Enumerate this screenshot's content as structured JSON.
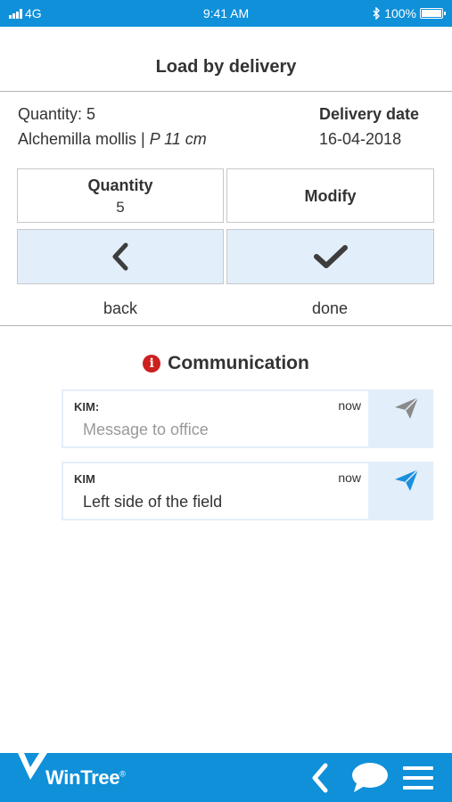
{
  "status_bar": {
    "carrier": "4G",
    "time": "9:41 AM",
    "battery": "100%"
  },
  "page_title": "Load by delivery",
  "delivery": {
    "quantity_text": "Quantity: 5",
    "product_name": "Alchemilla mollis |",
    "product_size": "P 11 cm",
    "date_label": "Delivery date",
    "date_value": "16-04-2018"
  },
  "actions": {
    "quantity_label": "Quantity",
    "quantity_value": "5",
    "modify_label": "Modify",
    "back_label": "back",
    "done_label": "done"
  },
  "communication": {
    "heading": "Communication",
    "messages": [
      {
        "sender": "KIM:",
        "time": "now",
        "placeholder": "Message to office",
        "text": "",
        "sent": false
      },
      {
        "sender": "KIM",
        "time": "now",
        "placeholder": "",
        "text": "Left side of the field",
        "sent": true
      }
    ]
  },
  "footer": {
    "brand": "WinTree",
    "trademark": "®"
  },
  "colors": {
    "brand_blue": "#0f90d9",
    "button_blue": "#e3eefb",
    "alert_red": "#cc1f1f",
    "send_active": "#1a8fdc",
    "send_inactive": "#8a8a8a"
  },
  "icons": [
    "signal-icon",
    "bluetooth-icon",
    "battery-icon",
    "chevron-left-icon",
    "checkmark-icon",
    "info-icon",
    "send-icon",
    "chat-icon",
    "menu-icon"
  ]
}
